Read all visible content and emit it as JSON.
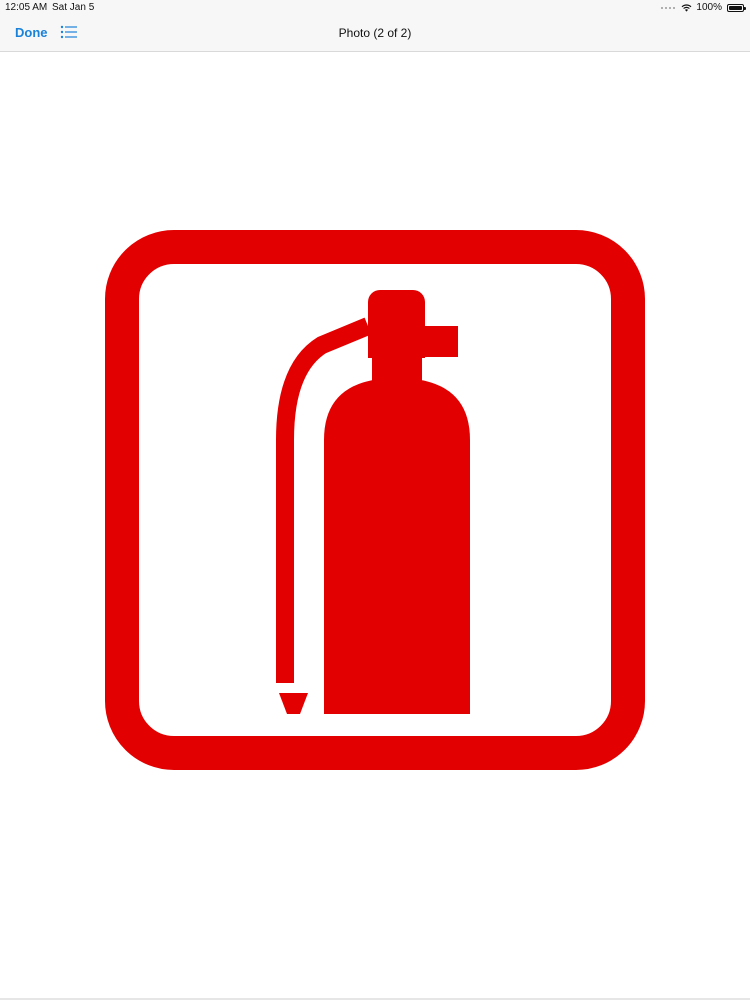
{
  "status_bar": {
    "time": "12:05 AM",
    "date": "Sat Jan 5",
    "battery": "100%",
    "wifi_icon": "wifi-icon",
    "battery_icon": "battery-icon"
  },
  "nav": {
    "done_label": "Done",
    "list_icon": "list-icon",
    "title": "Photo (2 of 2)"
  },
  "photo": {
    "subject": "fire-extinguisher-sign",
    "sign_color": "#e30000",
    "background_color": "#ffffff"
  },
  "colors": {
    "accent": "#1a82d9",
    "bar_background": "#f7f7f7"
  }
}
